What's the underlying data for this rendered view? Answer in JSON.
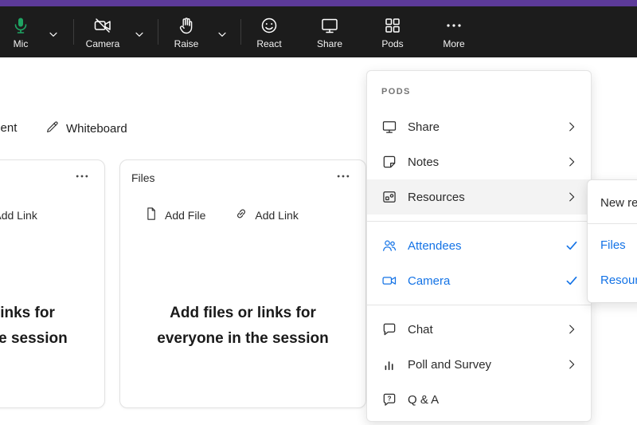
{
  "colors": {
    "purple_bar": "#5C3A99",
    "toolbar_bg": "#1C1C1C",
    "accent_blue": "#1473E6",
    "mic_green": "#1FA463",
    "hover_gray": "#F3F3F3"
  },
  "toolbar": {
    "items": [
      {
        "label": "Mic",
        "icon": "mic-icon",
        "dropdown": true
      },
      {
        "label": "Camera",
        "icon": "camera-off-icon",
        "dropdown": true
      },
      {
        "label": "Raise",
        "icon": "raise-hand-icon",
        "dropdown": true
      },
      {
        "label": "React",
        "icon": "react-smiley-icon",
        "dropdown": false
      },
      {
        "label": "Share",
        "icon": "share-screen-icon",
        "dropdown": false
      },
      {
        "label": "Pods",
        "icon": "pods-grid-icon",
        "dropdown": false
      },
      {
        "label": "More",
        "icon": "more-ellipsis-icon",
        "dropdown": false
      }
    ]
  },
  "subnav": {
    "tabs": [
      {
        "label": "Document"
      },
      {
        "label": "Whiteboard",
        "icon": "pen-icon"
      }
    ]
  },
  "pod_card": {
    "title": "Files",
    "add_file": "Add File",
    "add_link": "Add Link",
    "empty_line1": "Add files or links for",
    "empty_line2": "everyone in the session"
  },
  "pods_menu": {
    "header": "PODS",
    "items": [
      {
        "label": "Share",
        "icon": "share-screen-icon",
        "chevron": true,
        "checked": false,
        "active": false,
        "highlighted": false
      },
      {
        "label": "Notes",
        "icon": "notes-icon",
        "chevron": true,
        "checked": false,
        "active": false,
        "highlighted": false
      },
      {
        "label": "Resources",
        "icon": "resources-icon",
        "chevron": true,
        "checked": false,
        "active": false,
        "highlighted": true
      },
      {
        "label": "Attendees",
        "icon": "attendees-icon",
        "chevron": false,
        "checked": true,
        "active": true,
        "highlighted": false
      },
      {
        "label": "Camera",
        "icon": "camera-icon",
        "chevron": false,
        "checked": true,
        "active": true,
        "highlighted": false
      },
      {
        "label": "Chat",
        "icon": "chat-icon",
        "chevron": true,
        "checked": false,
        "active": false,
        "highlighted": false
      },
      {
        "label": "Poll and Survey",
        "icon": "poll-icon",
        "chevron": true,
        "checked": false,
        "active": false,
        "highlighted": false
      },
      {
        "label": "Q & A",
        "icon": "qa-icon",
        "chevron": false,
        "checked": false,
        "active": false,
        "highlighted": false
      }
    ]
  },
  "resources_submenu": {
    "items": [
      {
        "label": "New resource",
        "color": "default"
      },
      {
        "label": "Files",
        "color": "blue"
      },
      {
        "label": "Resources",
        "color": "blue"
      }
    ]
  }
}
